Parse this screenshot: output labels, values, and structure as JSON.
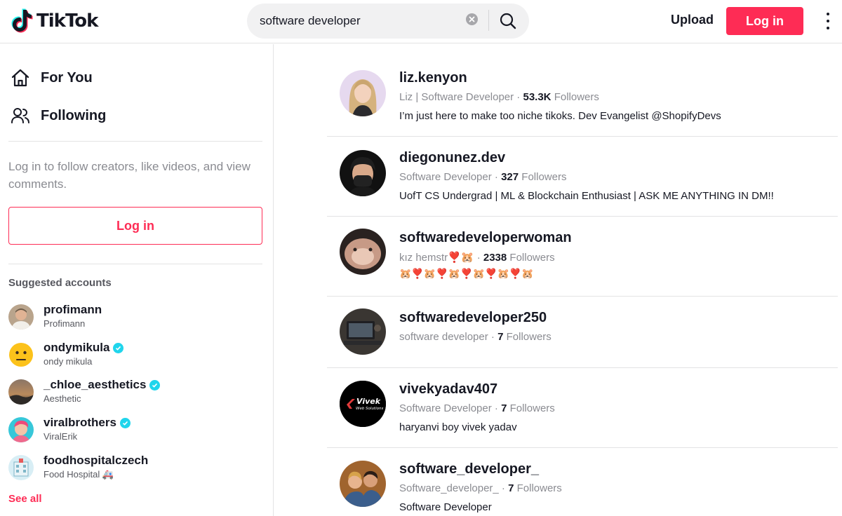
{
  "header": {
    "logo_text": "TikTok",
    "search_value": "software developer",
    "upload_label": "Upload",
    "login_label": "Log in"
  },
  "sidebar": {
    "nav": [
      {
        "label": "For You",
        "icon": "home-icon"
      },
      {
        "label": "Following",
        "icon": "people-icon"
      }
    ],
    "login_hint": "Log in to follow creators, like videos, and view comments.",
    "login_label": "Log in",
    "suggested_title": "Suggested accounts",
    "suggested": [
      {
        "username": "profimann",
        "display": "Profimann",
        "verified": false
      },
      {
        "username": "ondymikula",
        "display": "ondy mikula",
        "verified": true
      },
      {
        "username": "_chloe_aesthetics",
        "display": "Aesthetic",
        "verified": true
      },
      {
        "username": "viralbrothers",
        "display": "ViralErik",
        "verified": true
      },
      {
        "username": "foodhospitalczech",
        "display": "Food Hospital 🚑",
        "verified": false
      }
    ],
    "see_all": "See all"
  },
  "results": [
    {
      "username": "liz.kenyon",
      "nickname": "Liz | Software Developer",
      "followers": "53.3K",
      "followers_label": "Followers",
      "bio": "I’m just here to make too niche tikoks. Dev Evangelist @ShopifyDevs"
    },
    {
      "username": "diegonunez.dev",
      "nickname": "Software Developer",
      "followers": "327",
      "followers_label": "Followers",
      "bio": "UofT CS Undergrad | ML & Blockchain Enthusiast | ASK ME ANYTHING IN DM!!"
    },
    {
      "username": "softwaredeveloperwoman",
      "nickname": "kız hemstr❣️🐹",
      "followers": "2338",
      "followers_label": "Followers",
      "bio": "🐹❣️🐹❣️🐹❣️🐹❣️🐹❣️🐹"
    },
    {
      "username": "softwaredeveloper250",
      "nickname": "software developer",
      "followers": "7",
      "followers_label": "Followers",
      "bio": ""
    },
    {
      "username": "vivekyadav407",
      "nickname": "Software Developer",
      "followers": "7",
      "followers_label": "Followers",
      "bio": "haryanvi boy vivek yadav"
    },
    {
      "username": "software_developer_",
      "nickname": "Software_developer_",
      "followers": "7",
      "followers_label": "Followers",
      "bio": "Software Developer"
    }
  ],
  "avatar_text": {
    "vivek_logo": "Vivek",
    "vivek_logo_sub": "Web Solutions"
  },
  "colors": {
    "brand": "#fe2c55",
    "verified": "#20d5ec",
    "muted": "#8a8b91"
  }
}
